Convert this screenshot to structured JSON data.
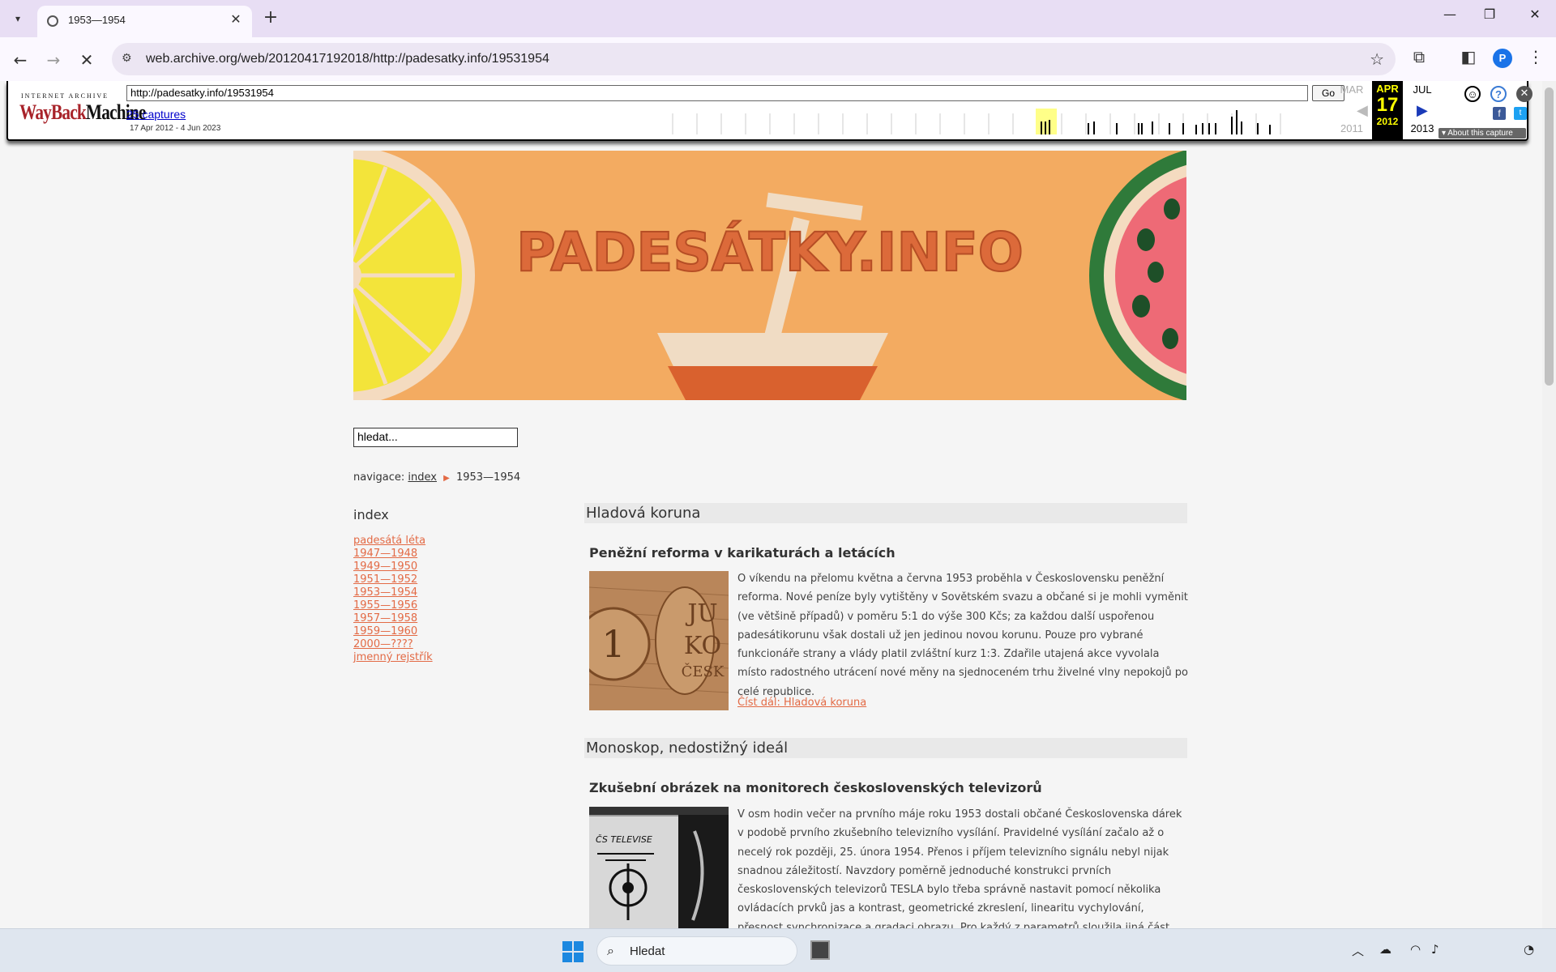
{
  "browser": {
    "tab_title": "1953—1954",
    "url": "web.archive.org/web/20120417192018/http://padesatky.info/19531954",
    "profile_initial": "P"
  },
  "wayback": {
    "logo_top": "INTERNET ARCHIVE",
    "logo_red": "WayBack",
    "logo_black": "Machine",
    "url": "http://padesatky.info/19531954",
    "go_label": "Go",
    "captures": "25 captures",
    "range": "17 Apr 2012 - 4 Jun 2023",
    "prev_month": "MAR",
    "cur_month": "APR",
    "next_month": "JUL",
    "cur_day": "17",
    "prev_year": "2011",
    "cur_year": "2012",
    "next_year": "2013",
    "about": "About this capture"
  },
  "site": {
    "banner_title": "PADESÁTKY.INFO",
    "search_value": "hledat...",
    "nav_label": "navigace:",
    "nav_link": "index",
    "nav_current": "1953—1954",
    "sidebar_title": "index",
    "sidebar_links": [
      "padesátá léta",
      "1947—1948",
      "1949—1950",
      "1951—1952",
      "1953—1954",
      "1955—1956",
      "1957—1958",
      "1959—1960",
      "2000—????",
      "jmenný rejstřík"
    ]
  },
  "articles": [
    {
      "section": "Hladová koruna",
      "title": "Peněžní reforma v karikaturách a letácích",
      "body": "O víkendu na přelomu května a června 1953 proběhla v Československu peněžní reforma. Nové peníze byly vytištěny v Sovětském svazu a občané si je mohli vyměnit (ve většině případů) v poměru 5:1 do výše 300 Kčs; za každou další uspořenou padesátikorunu však dostali už jen jedinou novou korunu. Pouze pro vybrané funkcionáře strany a vlády platil zvláštní kurz 1:3. Zdařile utajená akce vyvolala místo radostného utrácení nové měny na sjednoceném trhu živelné vlny nepokojů po celé republice.",
      "readmore": "Číst dál: Hladová koruna",
      "img_text": "1 KO ČESK"
    },
    {
      "section": "Monoskop, nedostižný ideál",
      "title": "Zkušební obrázek na monitorech československých televizorů",
      "body": "V osm hodin večer na prvního máje roku 1953 dostali občané Československa dárek v podobě prvního zkušebního televizního vysílání. Pravidelné vysílání začalo až o necelý rok později, 25. února 1954. Přenos i příjem televizního signálu nebyl nijak snadnou záležitostí. Navzdory poměrně jednoduché konstrukci prvních československých televizorů TESLA bylo třeba správně nastavit pomocí několika ovládacích prvků jas a kontrast, geometrické zkreslení, linearitu vychylování, přesnost synchronizace a gradaci obrazu. Pro každý z parametrů sloužila jiná část monoskopu, obrazce, podle kterého se televizory ladily.",
      "img_text": "ČS TELEVISE"
    }
  ],
  "taskbar": {
    "search_label": "Hledat"
  },
  "colors": {
    "accent_link": "#e36a45",
    "banner_bg": "#f3ab61",
    "wayback_red": "#a8232a"
  }
}
